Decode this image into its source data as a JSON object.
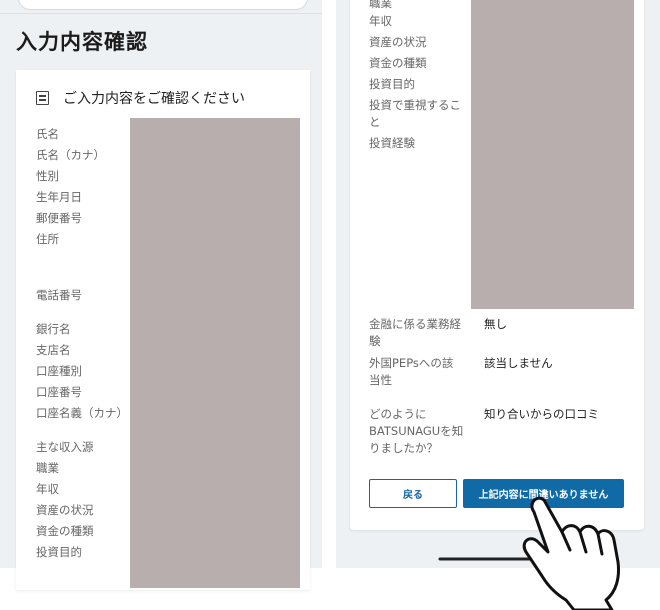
{
  "page": {
    "title": "入力内容確認"
  },
  "card": {
    "header": "ご入力内容をご確認ください"
  },
  "left_labels": [
    "氏名",
    "氏名（カナ）",
    "性別",
    "生年月日",
    "郵便番号",
    "住所",
    "電話番号",
    "銀行名",
    "支店名",
    "口座種別",
    "口座番号",
    "口座名義（カナ）",
    "主な収入源",
    "職業",
    "年収",
    "資産の状況",
    "資金の種類",
    "投資目的"
  ],
  "right_labels": [
    "職業",
    "年収",
    "資産の状況",
    "資金の種類",
    "投資目的",
    "投資で重視するこ",
    "と",
    "投資経験"
  ],
  "extra_rows": [
    {
      "label_lines": [
        "金融に係る業務経",
        "験"
      ],
      "value": "無し"
    },
    {
      "label_lines": [
        "外国PEPsへの該",
        "当性"
      ],
      "value": "該当しません"
    },
    {
      "label_lines": [
        "どのように",
        "BATSUNAGUを知",
        "りましたか？"
      ],
      "value": "知り合いからの口コミ"
    }
  ],
  "buttons": {
    "back": "戻る",
    "confirm": "上記内容に間違いありません"
  },
  "colors": {
    "background": "#eef1f4",
    "primary": "#0f6aa6",
    "redaction": "#b8aeae"
  }
}
